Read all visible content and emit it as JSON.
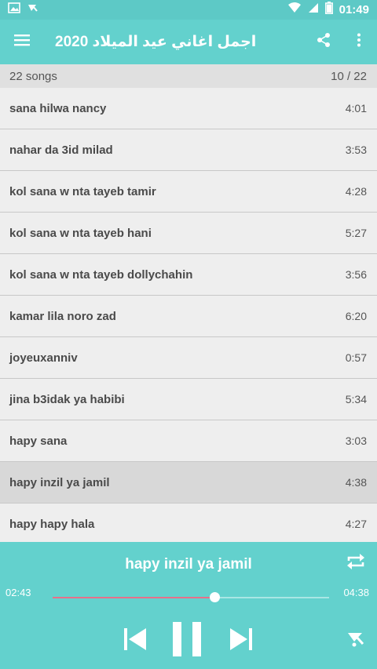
{
  "status_bar": {
    "time": "01:49",
    "battery_level": "2"
  },
  "app_bar": {
    "title": "اجمل اغاني عيد الميلاد 2020"
  },
  "summary": {
    "count_label": "22 songs",
    "position_label": "10 / 22"
  },
  "songs": [
    {
      "title": "sana hilwa nancy",
      "duration": "4:01"
    },
    {
      "title": "nahar da 3id milad",
      "duration": "3:53"
    },
    {
      "title": "kol sana w nta tayeb tamir",
      "duration": "4:28"
    },
    {
      "title": "kol sana w nta tayeb hani",
      "duration": "5:27"
    },
    {
      "title": "kol sana w nta tayeb dollychahin",
      "duration": "3:56"
    },
    {
      "title": "kamar lila noro zad",
      "duration": "6:20"
    },
    {
      "title": "joyeuxanniv",
      "duration": "0:57"
    },
    {
      "title": "jina b3idak ya habibi",
      "duration": "5:34"
    },
    {
      "title": "hapy sana",
      "duration": "3:03"
    },
    {
      "title": "hapy inzil ya jamil",
      "duration": "4:38"
    },
    {
      "title": "hapy hapy hala",
      "duration": "4:27"
    }
  ],
  "player": {
    "now_playing": "hapy inzil ya jamil",
    "elapsed": "02:43",
    "total": "04:38",
    "progress_fraction": 0.586
  },
  "colors": {
    "status_bar": "#5dc9c6",
    "primary": "#63d1cd",
    "seek_fill": "#e8708a",
    "active_row": "#d8d8d8"
  },
  "icons": {
    "menu": "hamburger-menu-icon",
    "share": "share-icon",
    "more": "more-vertical-icon",
    "repeat": "repeat-icon",
    "previous": "skip-previous-icon",
    "pause": "pause-icon",
    "next": "skip-next-icon",
    "logo": "app-logo-icon"
  }
}
